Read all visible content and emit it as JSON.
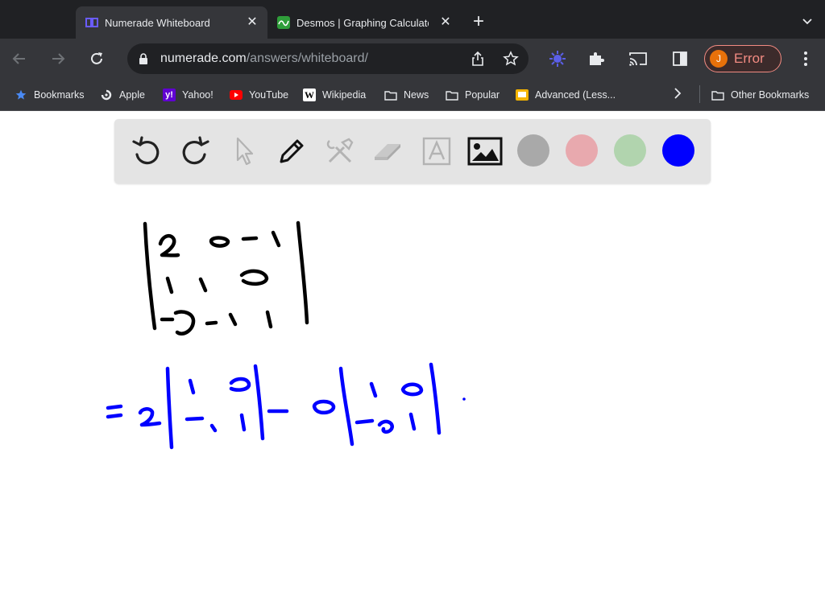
{
  "tabs": [
    {
      "title": "Numerade Whiteboard",
      "active": true,
      "icon": "numerade-favicon"
    },
    {
      "title": "Desmos | Graphing Calculator",
      "active": false,
      "icon": "desmos-favicon"
    }
  ],
  "address_bar": {
    "domain": "numerade.com",
    "path": "/answers/whiteboard/"
  },
  "profile": {
    "initial": "J",
    "status": "Error"
  },
  "bookmarks": [
    {
      "label": "Bookmarks",
      "icon": "star-icon"
    },
    {
      "label": "Apple",
      "icon": "apple-icon"
    },
    {
      "label": "Yahoo!",
      "icon": "yahoo-icon"
    },
    {
      "label": "YouTube",
      "icon": "youtube-icon"
    },
    {
      "label": "Wikipedia",
      "icon": "wikipedia-icon"
    },
    {
      "label": "News",
      "icon": "folder-icon"
    },
    {
      "label": "Popular",
      "icon": "folder-icon"
    },
    {
      "label": "Advanced (Less...",
      "icon": "bookmark-yellow-icon"
    },
    {
      "label": "Other Bookmarks",
      "icon": "folder-icon"
    }
  ],
  "whiteboard": {
    "tools": [
      "undo",
      "redo",
      "select",
      "pen",
      "tools",
      "eraser",
      "text",
      "image"
    ],
    "colors": [
      "#a9a9a9",
      "#e8a9ae",
      "#b1d4ae",
      "#0000ff"
    ],
    "selected_color": "#0000ff",
    "ink_colors": {
      "matrix": "#000000",
      "expansion": "#0000ff"
    }
  }
}
